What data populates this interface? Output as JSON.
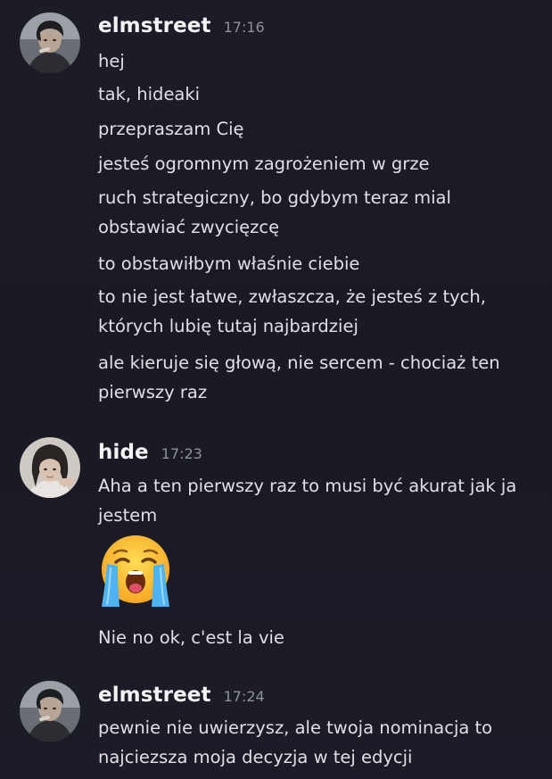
{
  "groups": [
    {
      "username": "elmstreet",
      "time": "17:16",
      "messages": [
        [
          "hej"
        ],
        [
          "tak, hideaki"
        ],
        [
          "przepraszam Cię"
        ],
        [
          "jesteś ogromnym zagrożeniem w grze"
        ],
        [
          "ruch strategiczny, bo gdybym teraz mial",
          "obstawiać zwycięzcę"
        ],
        [
          "to obstawiłbym właśnie ciebie"
        ],
        [
          "to nie jest łatwe, zwłaszcza, że jesteś z tych,",
          "których lubię tutaj najbardziej"
        ],
        [
          "ale kieruje się głową, nie sercem - chociaż ten",
          "pierwszy raz"
        ]
      ]
    },
    {
      "username": "hide",
      "time": "17:23",
      "messages": [
        [
          "Aha a ten pierwszy raz to musi być akurat jak ja",
          "jestem"
        ],
        [
          "Nie no ok, c'est la vie"
        ]
      ],
      "emoji": "loudly-crying-face"
    },
    {
      "username": "elmstreet",
      "time": "17:24",
      "messages": [
        [
          "pewnie nie uwierzysz, ale twoja nominacja to",
          "najciezsza moja decyzja w tej edycji"
        ]
      ]
    }
  ],
  "colors": {
    "background": "#1c1b26",
    "username": "#f2f3f5",
    "timestamp": "#8f919b",
    "text": "#dfe0e5"
  }
}
